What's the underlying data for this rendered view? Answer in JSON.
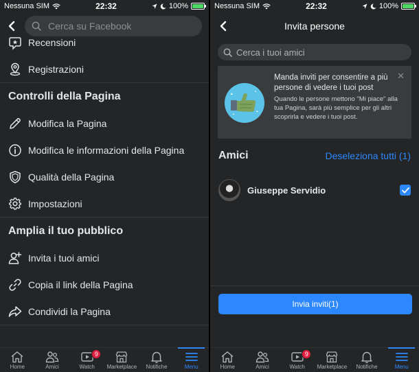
{
  "status_left": {
    "carrier": "Nessuna SIM",
    "time": "22:32",
    "battery": "100%"
  },
  "status_right": {
    "carrier": "Nessuna SIM",
    "time": "22:32",
    "battery": "100%"
  },
  "left": {
    "search_placeholder": "Cerca su Facebook",
    "items_top": [
      {
        "label": "Recensioni",
        "icon": "reviews-icon"
      },
      {
        "label": "Registrazioni",
        "icon": "location-pin-icon"
      }
    ],
    "section_controls": "Controlli della Pagina",
    "items_controls": [
      {
        "label": "Modifica la Pagina",
        "icon": "pencil-icon"
      },
      {
        "label": "Modifica le informazioni della Pagina",
        "icon": "info-icon"
      },
      {
        "label": "Qualità della Pagina",
        "icon": "shield-icon"
      },
      {
        "label": "Impostazioni",
        "icon": "gear-icon"
      }
    ],
    "section_audience": "Amplia il tuo pubblico",
    "items_audience": [
      {
        "label": "Invita i tuoi amici",
        "icon": "add-person-icon"
      },
      {
        "label": "Copia il link della Pagina",
        "icon": "link-icon"
      },
      {
        "label": "Condividi la Pagina",
        "icon": "share-icon"
      }
    ]
  },
  "tabs": [
    {
      "label": "Home",
      "icon": "home-icon"
    },
    {
      "label": "Amici",
      "icon": "friends-icon"
    },
    {
      "label": "Watch",
      "icon": "watch-icon",
      "badge": "9"
    },
    {
      "label": "Marketplace",
      "icon": "marketplace-icon"
    },
    {
      "label": "Notifiche",
      "icon": "bell-icon"
    },
    {
      "label": "Menu",
      "icon": "hamburger-icon",
      "active": true
    }
  ],
  "right": {
    "title": "Invita persone",
    "search_placeholder": "Cerca i tuoi amici",
    "promo_title": "Manda inviti per consentire a più persone di vedere i tuoi post",
    "promo_body": "Quando le persone mettono \"Mi piace\" alla tua Pagina, sarà più semplice per gli altri scoprirla e vedere i tuoi post.",
    "friends_label": "Amici",
    "deselect_label": "Deseleziona tutti (1)",
    "friend_name": "Giuseppe Servidio",
    "invite_button": "Invia inviti(1)"
  },
  "colors": {
    "accent": "#2d88ff",
    "background": "#242526",
    "surface": "#3a3b3c",
    "badge": "#e41e3f"
  }
}
